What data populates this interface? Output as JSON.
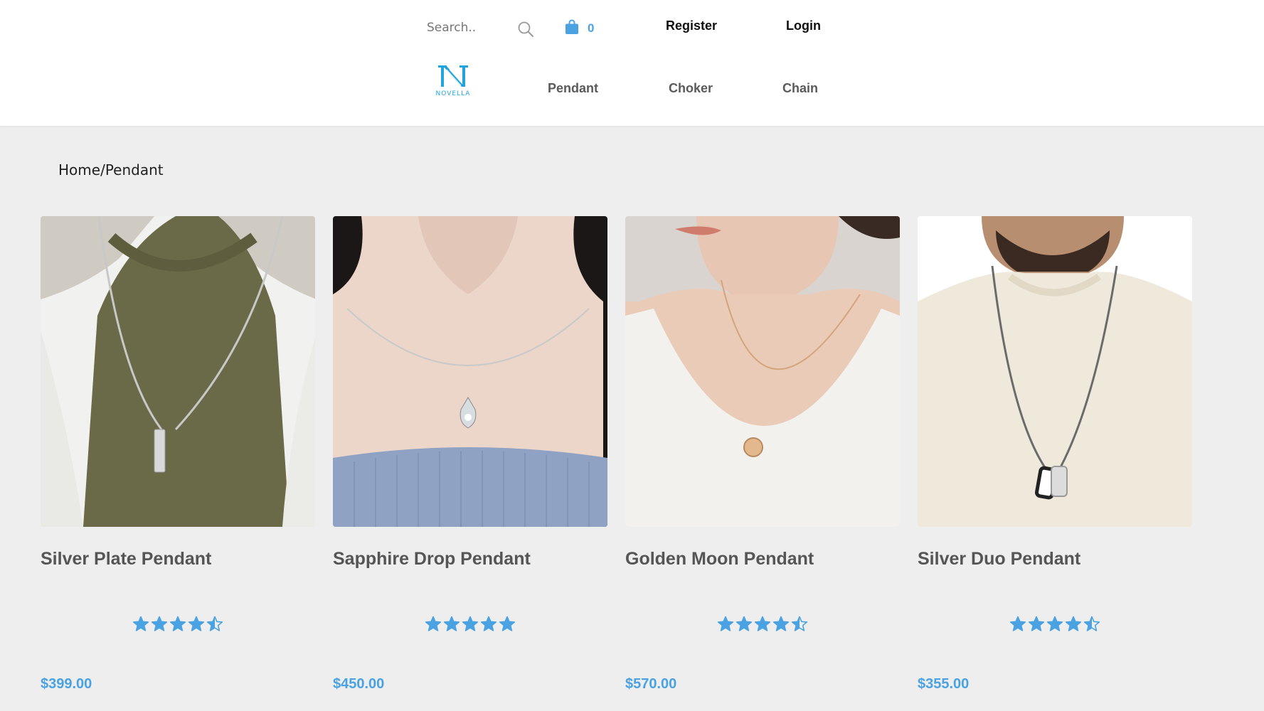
{
  "header": {
    "search": {
      "placeholder": "Search..",
      "value": ""
    },
    "cart": {
      "count": "0"
    },
    "register_label": "Register",
    "login_label": "Login",
    "logo": {
      "text": "NOVELLA",
      "color": "#21a4dc"
    },
    "nav": [
      {
        "label": "Pendant"
      },
      {
        "label": "Choker"
      },
      {
        "label": "Chain"
      }
    ]
  },
  "breadcrumb": {
    "home": "Home",
    "separator": "/",
    "current": "Pendant"
  },
  "accent_color": "#4aa2e3",
  "products": [
    {
      "name": "Silver Plate Pendant",
      "rating": 4.5,
      "price": "$399.00",
      "image": "man-olive-tee-silver-bar-pendant"
    },
    {
      "name": "Sapphire Drop Pendant",
      "rating": 5,
      "price": "$450.00",
      "image": "woman-silver-teardrop-pendant"
    },
    {
      "name": "Golden Moon Pendant",
      "rating": 4.5,
      "price": "$570.00",
      "image": "woman-rose-gold-round-pendant"
    },
    {
      "name": "Silver Duo Pendant",
      "rating": 4.5,
      "price": "$355.00",
      "image": "man-cream-sweater-dogtag-pendant"
    }
  ]
}
